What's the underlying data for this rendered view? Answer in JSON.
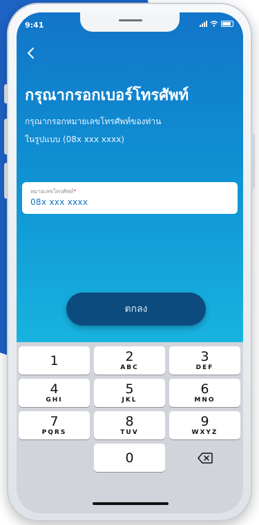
{
  "status_bar": {
    "time": "9:41"
  },
  "header": {
    "back_icon": "chevron-left-icon",
    "title": "กรุณากรอกเบอร์โทรศัพท์",
    "subtitle_line1": "กรุณากรอกหมายเลขโทรศัพท์ของท่าน",
    "subtitle_line2": "ในรูปแบบ (08x xxx xxxx)"
  },
  "phone_field": {
    "label": "หมายเลขโทรศัพท์",
    "required_mark": "*",
    "value": "08x xxx xxxx"
  },
  "confirm_button": {
    "label": "ตกลง"
  },
  "keypad": {
    "keys": [
      {
        "num": "1",
        "letters": ""
      },
      {
        "num": "2",
        "letters": "ABC"
      },
      {
        "num": "3",
        "letters": "DEF"
      },
      {
        "num": "4",
        "letters": "GHI"
      },
      {
        "num": "5",
        "letters": "JKL"
      },
      {
        "num": "6",
        "letters": "MNO"
      },
      {
        "num": "7",
        "letters": "PQRS"
      },
      {
        "num": "8",
        "letters": "TUV"
      },
      {
        "num": "9",
        "letters": "WXYZ"
      },
      {
        "num": "0",
        "letters": ""
      }
    ],
    "delete_icon": "backspace-icon"
  },
  "colors": {
    "brand_blue": "#1275c9",
    "button_dark": "#0d4b7e",
    "input_text": "#1272c6"
  }
}
